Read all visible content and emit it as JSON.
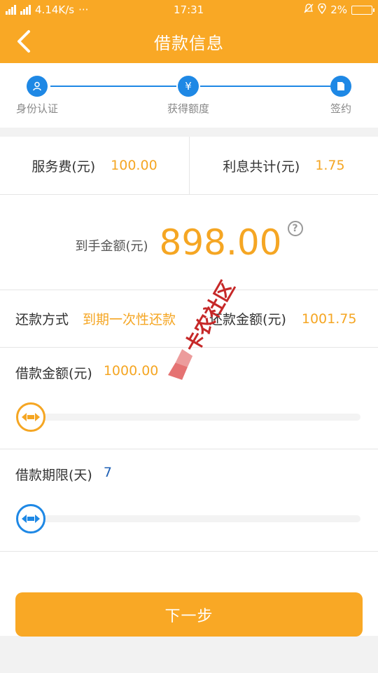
{
  "status_bar": {
    "network": "4.14K/s",
    "dots": "···",
    "time": "17:31",
    "battery": "2%"
  },
  "header": {
    "title": "借款信息"
  },
  "steps": [
    {
      "label": "身份认证",
      "icon": "user-icon"
    },
    {
      "label": "获得额度",
      "icon": "yuan-icon"
    },
    {
      "label": "签约",
      "icon": "document-icon"
    }
  ],
  "fees": {
    "service_label": "服务费(元)",
    "service_value": "100.00",
    "interest_label": "利息共计(元)",
    "interest_value": "1.75"
  },
  "received": {
    "label": "到手金额(元)",
    "amount": "898.00",
    "help": "?"
  },
  "repayment": {
    "method_label": "还款方式",
    "method_value": "到期一次性还款",
    "amount_label": "还款金额(元)",
    "amount_value": "1001.75"
  },
  "loan_amount": {
    "label": "借款金额(元)",
    "value": "1000.00",
    "slider_level": 0
  },
  "loan_term": {
    "label": "借款期限(天)",
    "value": "7",
    "slider_level": 0
  },
  "next_button": "下一步",
  "watermark": "卡农社区",
  "colors": {
    "brand_orange": "#f9a825",
    "accent_blue": "#1e88e5",
    "value_orange": "#f5a623"
  }
}
